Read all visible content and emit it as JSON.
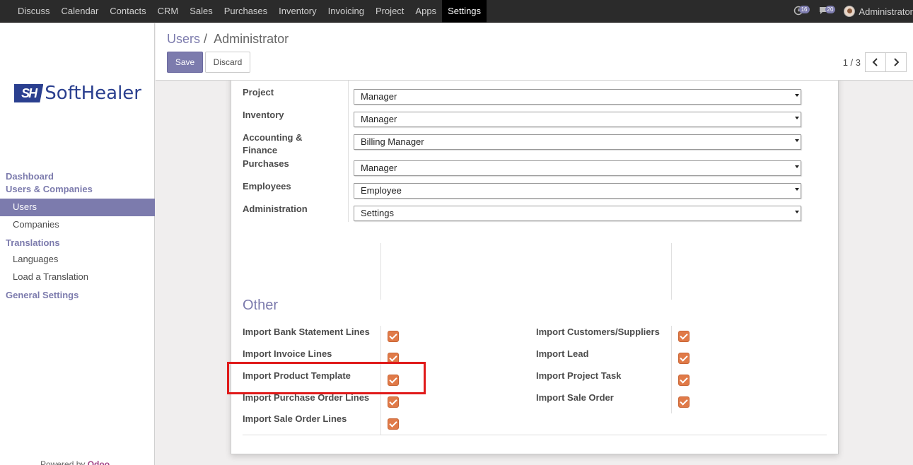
{
  "topbar": {
    "menu": [
      "Discuss",
      "Calendar",
      "Contacts",
      "CRM",
      "Sales",
      "Purchases",
      "Inventory",
      "Invoicing",
      "Project",
      "Apps",
      "Settings"
    ],
    "active": "Settings",
    "notifications": [
      {
        "icon": "clock-icon",
        "count": "16"
      },
      {
        "icon": "chat-icon",
        "count": "20"
      }
    ],
    "user": "Administrator"
  },
  "sidebar": {
    "logo": {
      "mark": "SH",
      "text": "SoftHealer"
    },
    "sections": [
      {
        "label": "Dashboard"
      },
      {
        "label": "Users & Companies",
        "items": [
          "Users",
          "Companies"
        ]
      },
      {
        "label": "Translations",
        "items": [
          "Languages",
          "Load a Translation"
        ]
      },
      {
        "label": "General Settings"
      }
    ],
    "active_item": "Users",
    "powered_by": "Powered by",
    "powered_brand": "Odoo"
  },
  "control": {
    "breadcrumb_parent": "Users",
    "breadcrumb_sep": "/",
    "breadcrumb_current": "Administrator",
    "save": "Save",
    "discard": "Discard",
    "pager": "1 / 3"
  },
  "access_rights": [
    {
      "label": "Project",
      "value": "Manager"
    },
    {
      "label": "Inventory",
      "value": "Manager"
    },
    {
      "label": "Accounting & Finance",
      "value": "Billing Manager"
    },
    {
      "label": "Purchases",
      "value": "Manager"
    },
    {
      "label": "Employees",
      "value": "Employee"
    },
    {
      "label": "Administration",
      "value": "Settings"
    }
  ],
  "other": {
    "title": "Other",
    "left": [
      {
        "label": "Import Bank Statement Lines",
        "checked": true
      },
      {
        "label": "Import Invoice Lines",
        "checked": true
      },
      {
        "label": "Import Product Template",
        "checked": true
      },
      {
        "label": "Import Purchase Order Lines",
        "checked": true
      },
      {
        "label": "Import Sale Order Lines",
        "checked": true
      }
    ],
    "right": [
      {
        "label": "Import Customers/Suppliers",
        "checked": true
      },
      {
        "label": "Import Lead",
        "checked": true
      },
      {
        "label": "Import Project Task",
        "checked": true
      },
      {
        "label": "Import Sale Order",
        "checked": true
      }
    ]
  },
  "colors": {
    "accent": "#7c7bad",
    "checkbox": "#e07a48",
    "highlight": "#e01a1a",
    "topbar": "#2b2b2b"
  }
}
